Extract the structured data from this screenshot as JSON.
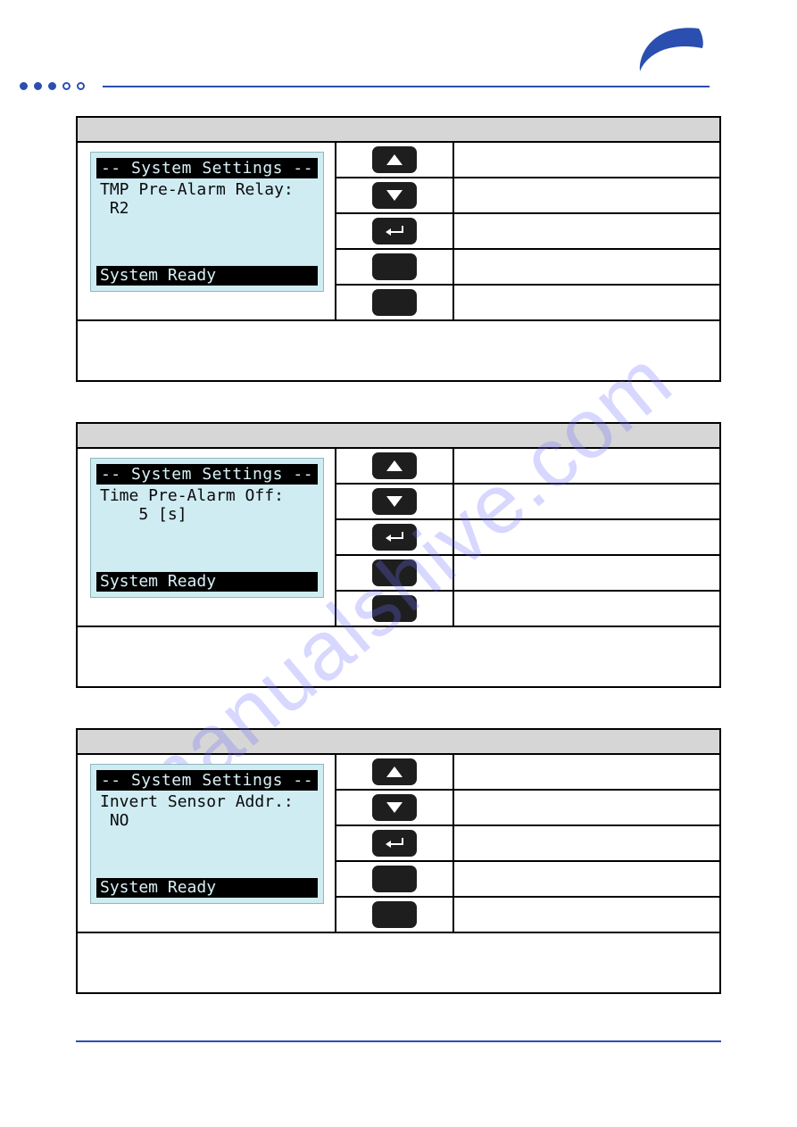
{
  "watermark": "manualshive.com",
  "panels": [
    {
      "lcd": {
        "header": "-- System Settings --",
        "line1": "TMP Pre-Alarm Relay:",
        "line2": " R2",
        "status": "System Ready"
      }
    },
    {
      "lcd": {
        "header": "-- System Settings --",
        "line1": "Time Pre-Alarm Off:",
        "line2": "    5 [s]",
        "status": "System Ready"
      }
    },
    {
      "lcd": {
        "header": "-- System Settings --",
        "line1": "Invert Sensor Addr.:",
        "line2": " NO",
        "status": "System Ready"
      }
    }
  ]
}
